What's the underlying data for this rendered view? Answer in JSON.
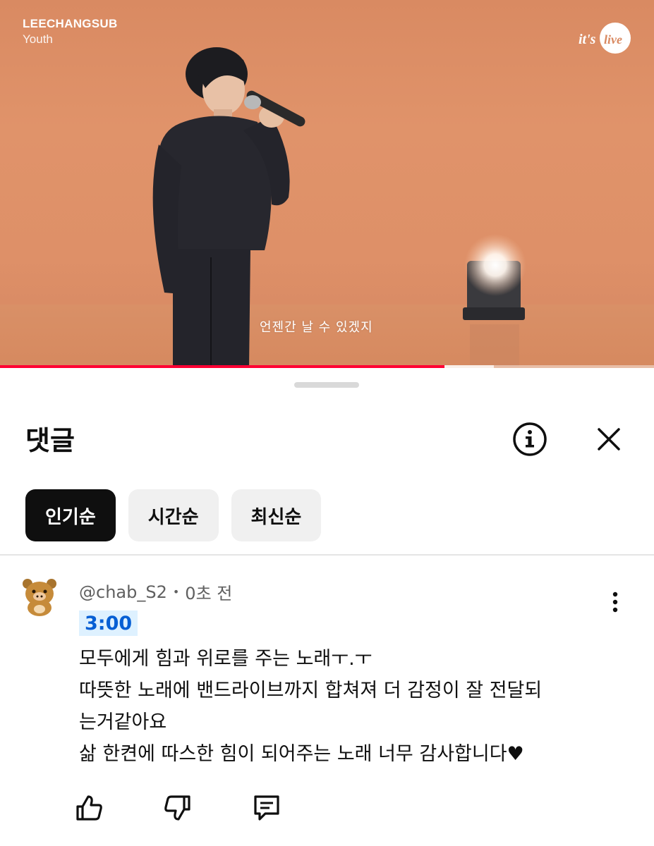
{
  "video": {
    "channel_title": "LEECHANGSUB",
    "song_title": "Youth",
    "logo_text": "it's live",
    "subtitle": "언젠간 날 수 있겠지",
    "progress": 0.68,
    "buffered": 0.755
  },
  "comments_panel": {
    "title": "댓글",
    "sort_chips": [
      {
        "label": "인기순",
        "active": true
      },
      {
        "label": "시간순",
        "active": false
      },
      {
        "label": "최신순",
        "active": false
      }
    ]
  },
  "comment": {
    "author": "@chab_S2",
    "separator": "•",
    "time": "0초 전",
    "timestamp_link": "3:00",
    "lines": [
      "모두에게 힘과 위로를 주는 노래ㅜ.ㅜ",
      "따뜻한 노래에 밴드라이브까지 합쳐져 더 감정이 잘 전달되",
      "는거같아요",
      "삶 한켠에 따스한 힘이 되어주는 노래 너무 감사합니다♥"
    ]
  },
  "icons": {
    "info": "info-icon",
    "close": "close-icon",
    "more": "more-vert-icon",
    "like": "thumb-up-icon",
    "dislike": "thumb-down-icon",
    "reply": "comment-icon"
  },
  "colors": {
    "video_bg": "#e0936a",
    "progress": "#ff0033",
    "timestamp_bg": "#def1ff",
    "timestamp_text": "#065fd4",
    "chip_active": "#0f0f0f",
    "chip_inactive": "#f0f0f0"
  }
}
